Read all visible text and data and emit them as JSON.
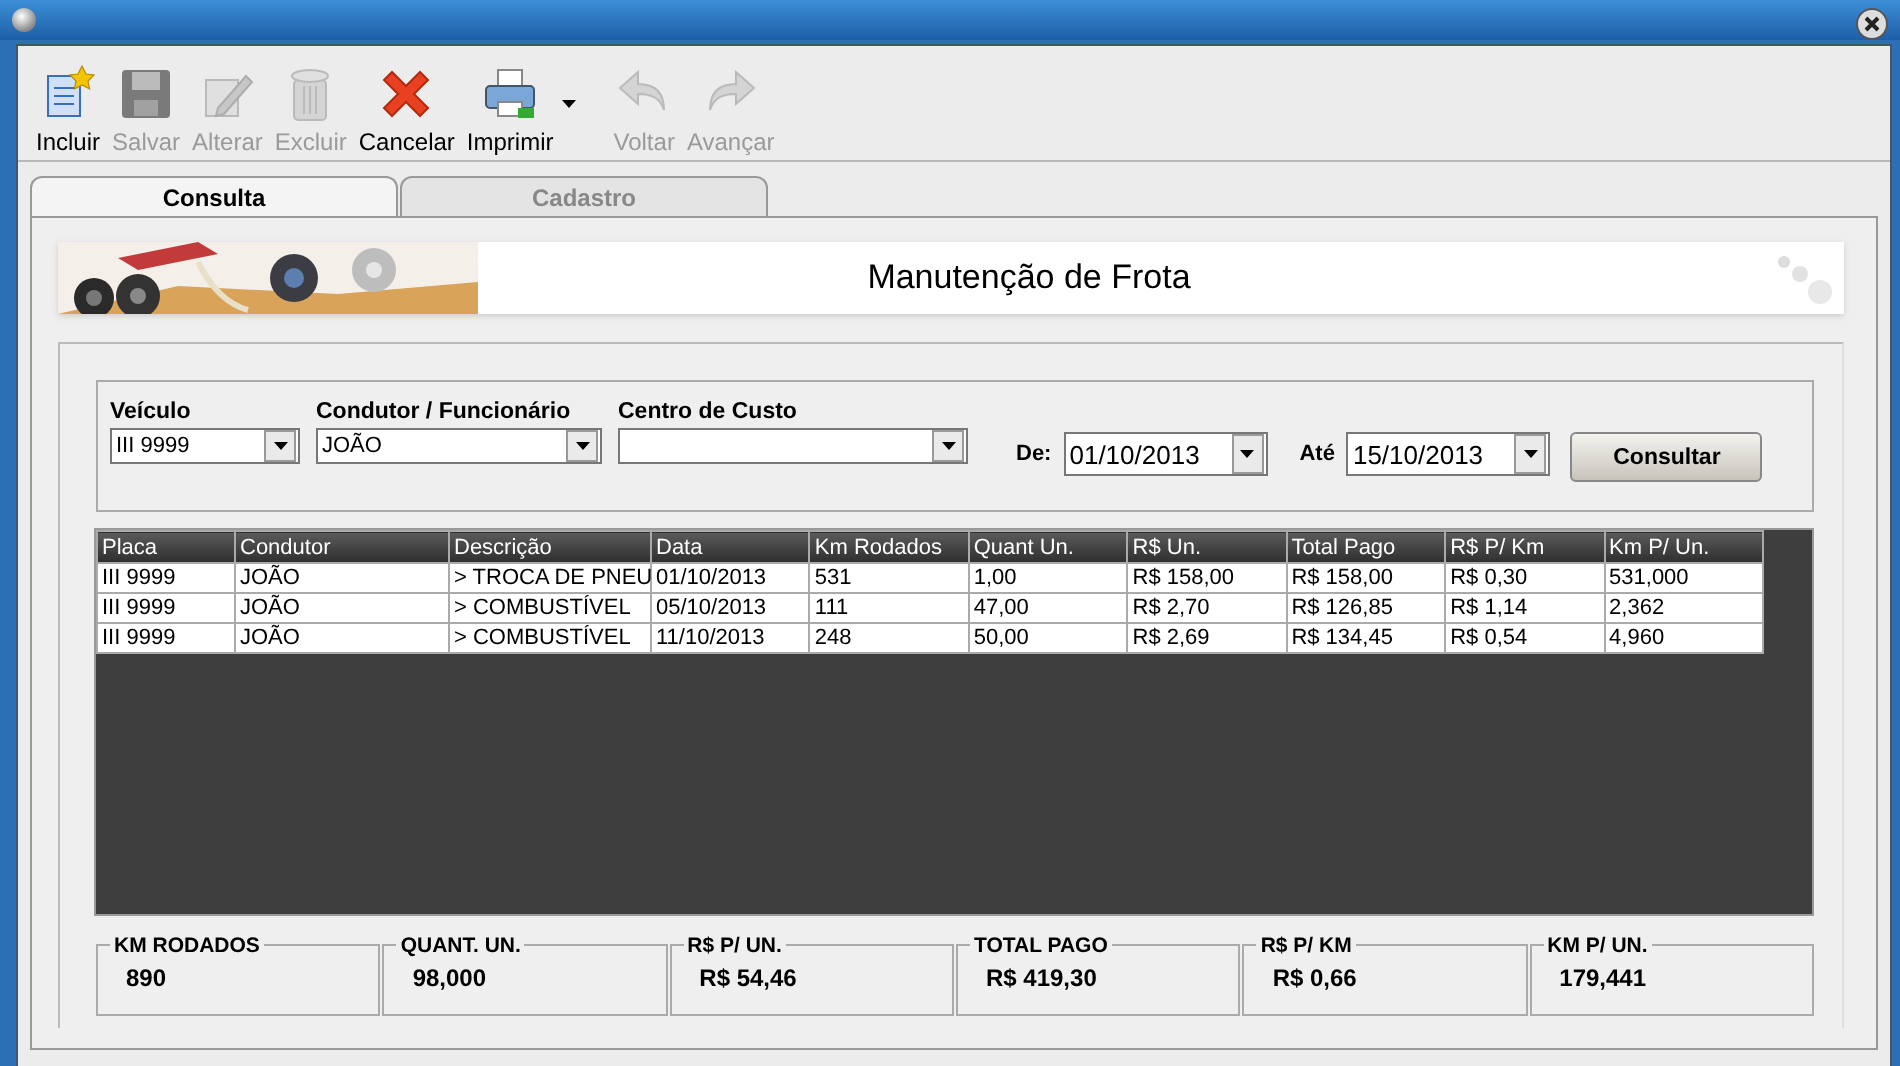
{
  "toolbar": [
    {
      "label": "Incluir",
      "kind": "new",
      "disabled": false
    },
    {
      "label": "Salvar",
      "kind": "save",
      "disabled": true
    },
    {
      "label": "Alterar",
      "kind": "edit",
      "disabled": true
    },
    {
      "label": "Excluir",
      "kind": "trash",
      "disabled": true
    },
    {
      "label": "Cancelar",
      "kind": "cancel",
      "disabled": false
    },
    {
      "label": "Imprimir",
      "kind": "print",
      "disabled": false
    },
    {
      "label": "Voltar",
      "kind": "back",
      "disabled": true
    },
    {
      "label": "Avançar",
      "kind": "forward",
      "disabled": true
    }
  ],
  "tabs": [
    {
      "label": "Consulta",
      "selected": true
    },
    {
      "label": "Cadastro",
      "selected": false
    }
  ],
  "banner": {
    "title": "Manutenção de Frota"
  },
  "filters": {
    "vehicle": {
      "label": "Veículo",
      "value": "III 9999"
    },
    "driver": {
      "label": "Condutor / Funcionário",
      "value": "JOÃO"
    },
    "cost_center": {
      "label": "Centro de Custo"
    },
    "from": {
      "label": "De:",
      "value": "01/10/2013"
    },
    "to": {
      "label": "Até",
      "value": "15/10/2013"
    },
    "button": "Consultar"
  },
  "table": {
    "columns": [
      "Placa",
      "Condutor",
      "Descrição",
      "Data",
      "Km Rodados",
      "Quant Un.",
      "R$ Un.",
      "Total Pago",
      "R$ P/ Km",
      "Km P/ Un."
    ],
    "rows": [
      [
        "III 9999",
        "JOÃO",
        "> TROCA DE PNEU",
        "01/10/2013",
        "531",
        "1,00",
        "R$ 158,00",
        "R$ 158,00",
        "R$ 0,30",
        "531,000"
      ],
      [
        "III 9999",
        "JOÃO",
        "> COMBUSTÍVEL",
        "05/10/2013",
        "111",
        "47,00",
        "R$ 2,70",
        "R$ 126,85",
        "R$ 1,14",
        "2,362"
      ],
      [
        "III 9999",
        "JOÃO",
        "> COMBUSTÍVEL",
        "11/10/2013",
        "248",
        "50,00",
        "R$ 2,69",
        "R$ 134,45",
        "R$ 0,54",
        "4,960"
      ]
    ]
  },
  "totals": [
    {
      "label": "KM RODADOS",
      "value": "890"
    },
    {
      "label": "QUANT. UN.",
      "value": "98,000"
    },
    {
      "label": "R$ P/ UN.",
      "value": "R$ 54,46"
    },
    {
      "label": "TOTAL PAGO",
      "value": "R$ 419,30"
    },
    {
      "label": "R$ P/ KM",
      "value": "R$ 0,66"
    },
    {
      "label": "KM P/ UN.",
      "value": "179,441"
    }
  ]
}
